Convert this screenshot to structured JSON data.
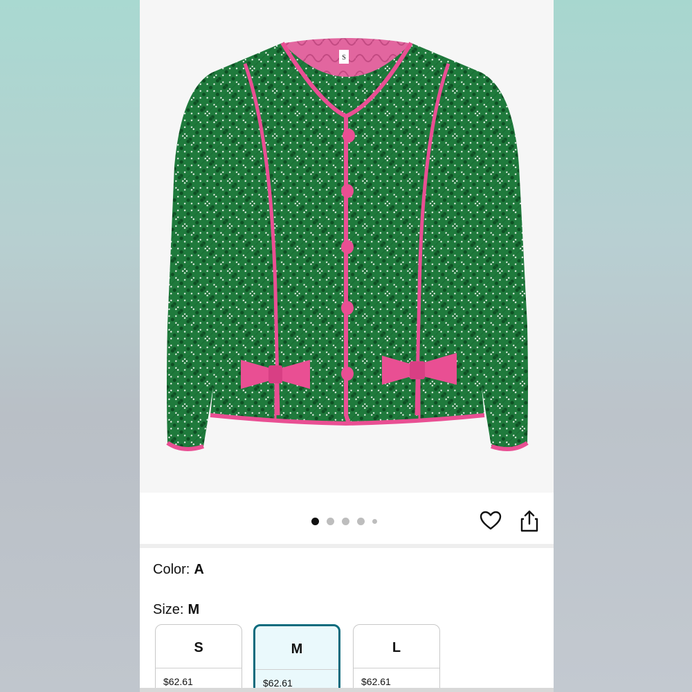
{
  "product": {
    "image_alt": "Green quilted jacket with pink trim and bows",
    "colors": {
      "jacket": "#1f7a3c",
      "trim": "#e94f93",
      "lining": "#e2669f",
      "accent": "#0a6b7d"
    },
    "neck_tag": "S"
  },
  "gallery": {
    "dots": [
      {
        "active": true
      },
      {
        "active": false
      },
      {
        "active": false
      },
      {
        "active": false
      },
      {
        "active": false,
        "small": true
      }
    ],
    "icons": [
      "heart-icon",
      "share-icon"
    ]
  },
  "attributes": {
    "color_label": "Color:",
    "color_value": "A",
    "size_label": "Size:",
    "size_value": "M"
  },
  "sizes": [
    {
      "label": "S",
      "price": "$62.61",
      "selected": false
    },
    {
      "label": "M",
      "price": "$62.61",
      "selected": true
    },
    {
      "label": "L",
      "price": "$62.61",
      "selected": false
    }
  ]
}
